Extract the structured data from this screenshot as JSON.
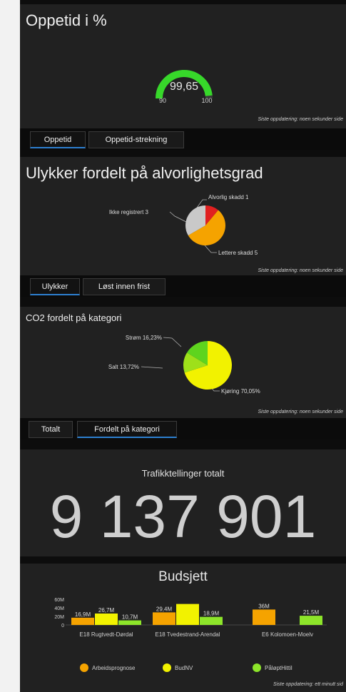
{
  "uptime": {
    "title": "Oppetid i %",
    "gauge": {
      "value": "99,65",
      "min": "90",
      "max": "100",
      "fraction": 0.965,
      "color": "#37d82a"
    },
    "updated": "Siste oppdatering: noen sekunder side",
    "tabs": [
      "Oppetid",
      "Oppetid-strekning"
    ]
  },
  "accidents": {
    "title": "Ulykker fordelt på alvorlighetsgrad",
    "labels": {
      "severe": "Alvorlig skadd 1",
      "unregistered": "Ikke registrert 3",
      "minor": "Lettere skadd 5"
    },
    "updated": "Siste oppdatering: noen sekunder side",
    "tabs": [
      "Ulykker",
      "Løst innen frist"
    ],
    "chart_data": {
      "type": "pie",
      "slices": [
        {
          "label": "Alvorlig skadd",
          "value": 1,
          "color": "#e02020"
        },
        {
          "label": "Lettere skadd",
          "value": 5,
          "color": "#f5a300"
        },
        {
          "label": "Ikke registrert",
          "value": 3,
          "color": "#c9c9c9"
        }
      ]
    }
  },
  "co2": {
    "title": "CO2 fordelt på kategori",
    "labels": {
      "power": "Strøm 16,23%",
      "salt": "Salt 13,72%",
      "driving": "Kjøring 70,05%"
    },
    "updated": "Siste oppdatering: noen sekunder side",
    "tabs": [
      "Totalt",
      "Fordelt på kategori"
    ],
    "chart_data": {
      "type": "pie",
      "slices": [
        {
          "label": "Kjøring",
          "value": 70.05,
          "color": "#f2f200"
        },
        {
          "label": "Salt",
          "value": 13.72,
          "color": "#9ee01a"
        },
        {
          "label": "Strøm",
          "value": 16.23,
          "color": "#5ed41e"
        }
      ]
    }
  },
  "traffic": {
    "title": "Trafikktellinger totalt",
    "value": "9 137 901"
  },
  "budget": {
    "title": "Budsjett",
    "updated": "Siste oppdatering: ett minutt sid",
    "chart_data": {
      "type": "bar",
      "categories": [
        "E18 Rugtvedt-Dørdal",
        "E18 Tvedestrand-Arendal",
        "E6 Kolomoen-Moelv"
      ],
      "yticks": [
        "60M",
        "40M",
        "20M",
        "0"
      ],
      "ylim": [
        0,
        60
      ],
      "series": [
        {
          "name": "Arbeidsprognose",
          "color": "#f5a300",
          "values": [
            16.9,
            29.4,
            36
          ],
          "labels": [
            "16,9M",
            "29,4M",
            "36M"
          ]
        },
        {
          "name": "BudNV",
          "color": "#f2f200",
          "values": [
            26.7,
            49,
            null
          ],
          "labels": [
            "26,7M",
            "",
            ""
          ]
        },
        {
          "name": "PåløptHittil",
          "color": "#8de52a",
          "values": [
            10.7,
            18.9,
            21.5
          ],
          "labels": [
            "10,7M",
            "18,9M",
            "21,5M"
          ]
        }
      ]
    }
  }
}
